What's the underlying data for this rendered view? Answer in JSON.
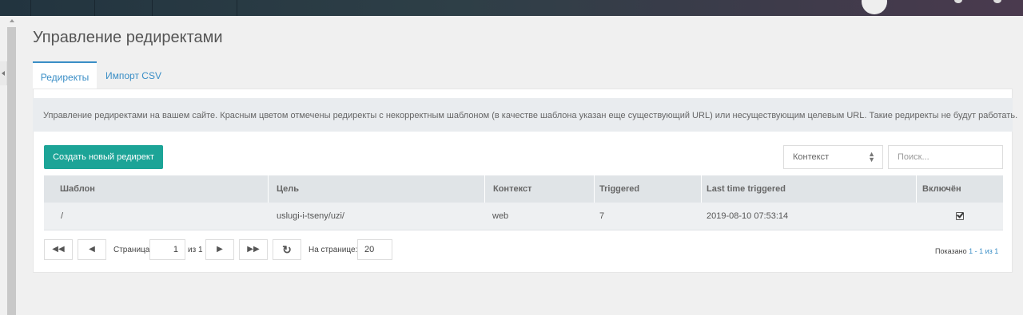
{
  "page": {
    "title": "Управление редиректами"
  },
  "tabs": [
    {
      "label": "Редиректы",
      "active": true
    },
    {
      "label": "Импорт CSV",
      "active": false
    }
  ],
  "description": "Управление редиректами на вашем сайте. Красным цветом отмечены редиректы с некорректным шаблоном (в качестве шаблона указан еще существующий URL) или несуществующим целевым URL. Такие редиректы не будут работать.",
  "toolbar": {
    "create_label": "Создать новый редирект",
    "context_select": "Контекст",
    "search_placeholder": "Поиск..."
  },
  "table": {
    "columns": [
      "Шаблон",
      "Цель",
      "Контекст",
      "Triggered",
      "Last time triggered",
      "Включён"
    ],
    "rows": [
      {
        "pattern": "/",
        "target": "uslugi-i-tseny/uzi/",
        "context": "web",
        "triggered": "7",
        "last_triggered": "2019-08-10 07:53:14",
        "enabled": true
      }
    ]
  },
  "pager": {
    "page_label": "Страница",
    "page_value": "1",
    "of_label": "из 1",
    "per_page_label": "На странице:",
    "per_page_value": "20",
    "shown_prefix": "Показано ",
    "shown_range": "1 - 1 из 1"
  },
  "colors": {
    "accent": "#3a8ec6",
    "create_button": "#1ca497"
  }
}
